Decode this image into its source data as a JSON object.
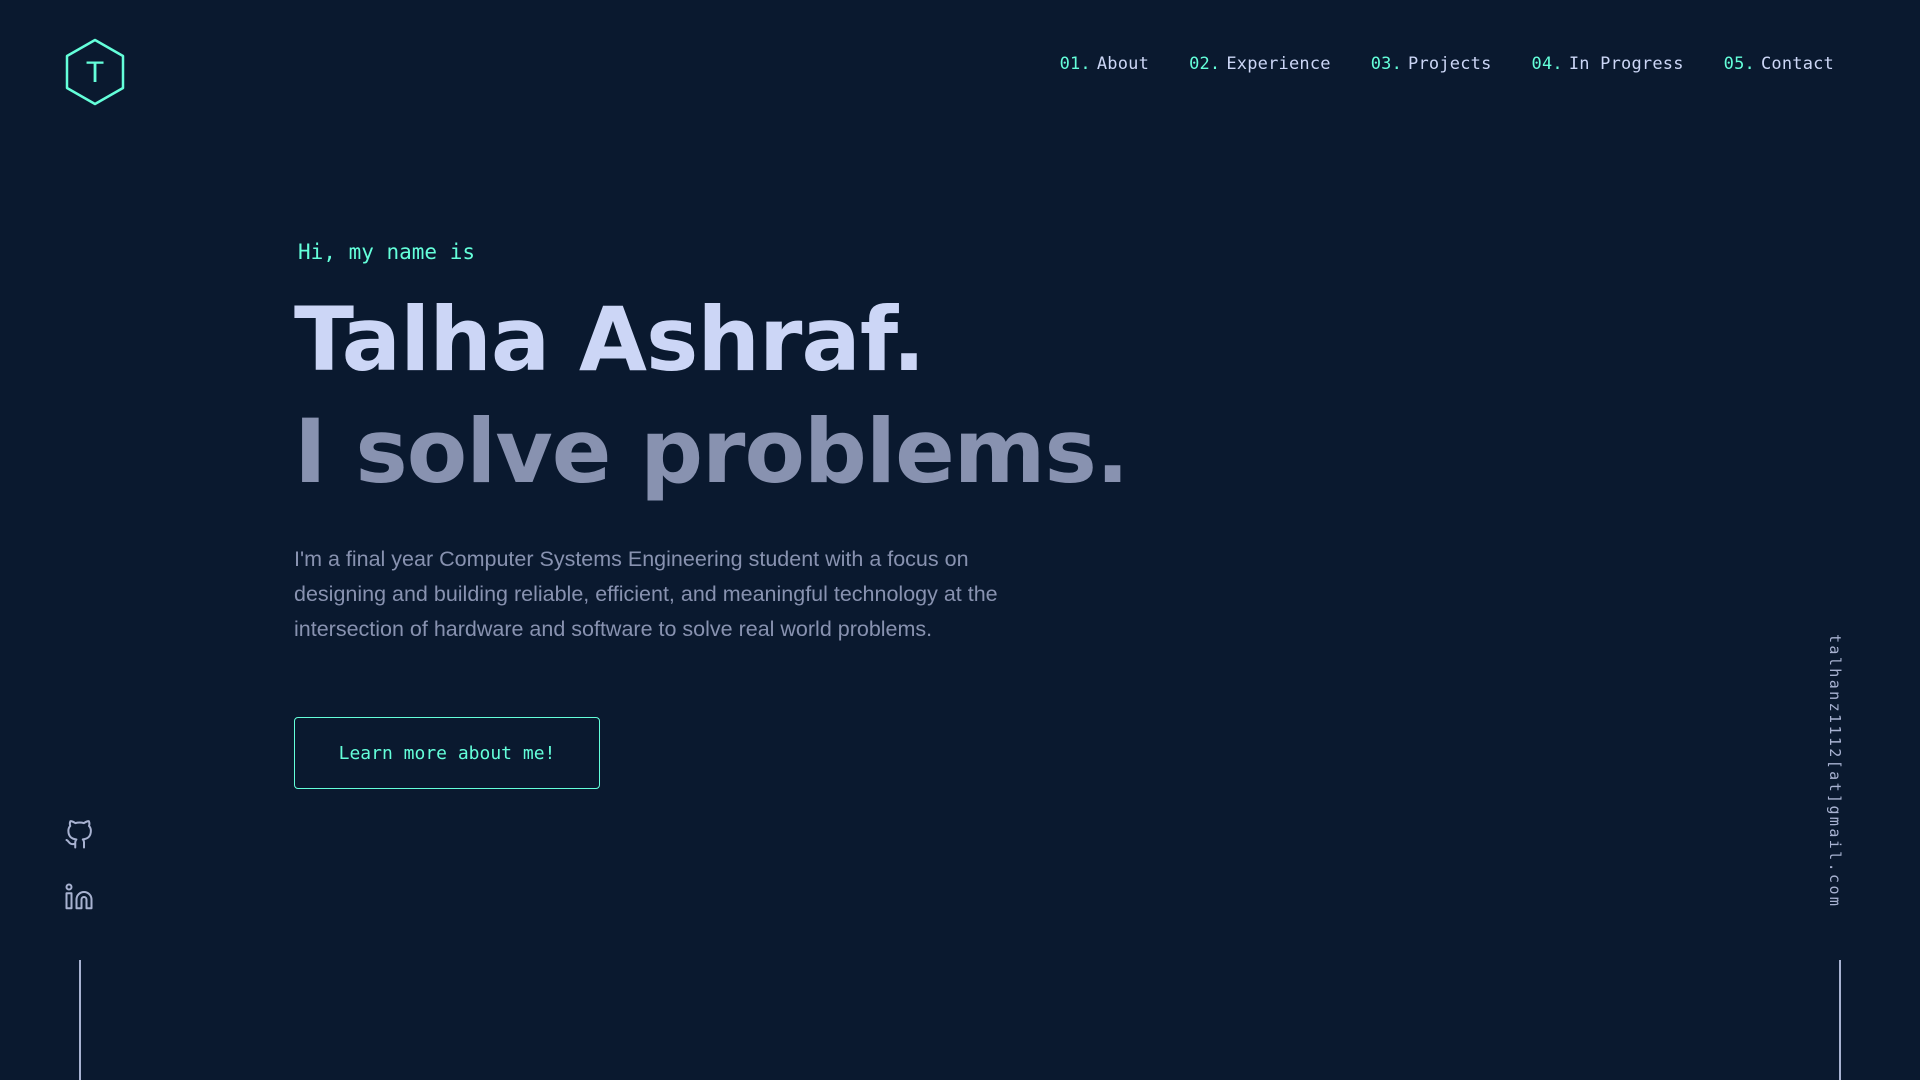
{
  "logo": {
    "letter": "T",
    "icon": "hexagon-logo-icon"
  },
  "nav": {
    "items": [
      {
        "num": "01.",
        "label": "About"
      },
      {
        "num": "02.",
        "label": "Experience"
      },
      {
        "num": "03.",
        "label": "Projects"
      },
      {
        "num": "04.",
        "label": "In Progress"
      },
      {
        "num": "05.",
        "label": "Contact"
      }
    ]
  },
  "hero": {
    "greeting": "Hi, my name is",
    "name": "Talha Ashraf.",
    "tagline": "I solve problems.",
    "bio": "I'm a final year Computer Systems Engineering student with a focus on designing and building reliable, efficient, and meaningful technology at the intersection of hardware and software to solve real world problems.",
    "cta_label": "Learn more about me!"
  },
  "social": {
    "links": [
      {
        "icon": "github-icon"
      },
      {
        "icon": "linkedin-icon"
      }
    ]
  },
  "email": "talhanz1112[at]gmail.com",
  "colors": {
    "background": "#0a192f",
    "accent": "#64ffda",
    "heading": "#ccd6f6",
    "text": "#8892b0"
  }
}
